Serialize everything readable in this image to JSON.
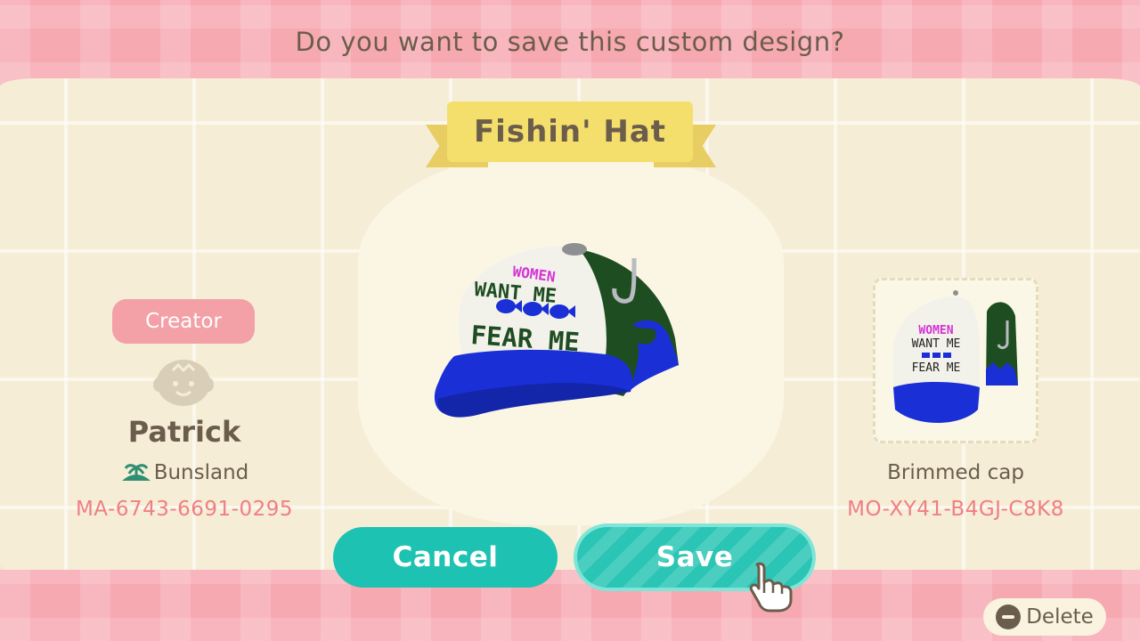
{
  "dialog": {
    "question": "Do you want to save this custom design?",
    "design_name": "Fishin' Hat"
  },
  "creator": {
    "badge_label": "Creator",
    "name": "Patrick",
    "island": "Bunsland",
    "creator_code": "MA-6743-6691-0295",
    "avatar_icon": "villager-face-icon",
    "island_icon": "island-icon"
  },
  "pattern": {
    "type": "Brimmed cap",
    "design_code": "MO-XY41-B4GJ-C8K8",
    "hat_text": {
      "line1": "WOMEN",
      "line2": "WANT ME",
      "line3": "FEAR ME"
    }
  },
  "buttons": {
    "cancel_label": "Cancel",
    "save_label": "Save",
    "delete_label": "Delete"
  },
  "colors": {
    "accent_teal": "#1ec2b2",
    "pink": "#f3a0a6",
    "code_pink": "#ef7f83",
    "cap_blue": "#1a2fd6",
    "cap_green": "#1f4d22",
    "text_brown": "#6b5d4b"
  }
}
